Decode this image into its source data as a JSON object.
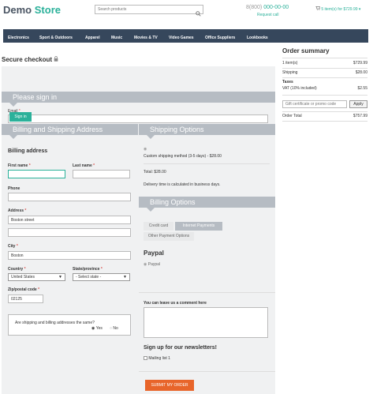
{
  "header": {
    "logo_part1": "Demo",
    "logo_part2": "Store",
    "search_placeholder": "Search products",
    "phone_prefix": "8(800)",
    "phone_number": "000-00-00",
    "request_call": "Request call",
    "cart_text": "5 item(s) for $729.99"
  },
  "nav": [
    "Electronics",
    "Sport & Outdoors",
    "Apparel",
    "Music",
    "Movies & TV",
    "Video Games",
    "Office Suppliers",
    "Lookbooks"
  ],
  "checkout": {
    "title": "Secure checkout",
    "sign_in_band": "Please sign in",
    "email_label": "Email",
    "sign_in_button": "Sign in",
    "billing_shipping_band": "Billing and Shipping Address",
    "billing_address_title": "Billing address",
    "first_name_label": "First name",
    "last_name_label": "Last name",
    "phone_label": "Phone",
    "address_label": "Address",
    "address_value": "Boston street",
    "city_label": "City",
    "city_value": "Boston",
    "country_label": "Country",
    "country_value": "United States",
    "state_label": "State/province",
    "state_value": "- Select state -",
    "zip_label": "Zip/postal code",
    "zip_value": "02125",
    "same_address_question": "Are shipping and billing addresses the same?",
    "yes_label": "Yes",
    "no_label": "No"
  },
  "shipping": {
    "band": "Shipping Options",
    "method": "Custom shipping method (3-5 days) - $28.00",
    "total": "Total: $28.00",
    "note": "Delivery time is calculated in business days."
  },
  "billing": {
    "band": "Billing Options",
    "tabs": [
      "Credit card",
      "Internet Payments",
      "Other Payment Options"
    ],
    "paypal_title": "Paypal",
    "paypal_option": "Paypal",
    "comment_label": "You can leave us a comment here",
    "newsletter_title": "Sign up for our newsletters!",
    "mailing_list": "Mailing list 1",
    "submit": "SUBMIT MY ORDER"
  },
  "summary": {
    "title": "Order summary",
    "items_label": "1 item(s)",
    "items_value": "$729.99",
    "shipping_label": "Shipping",
    "shipping_value": "$28.00",
    "taxes_label": "Taxes",
    "vat_label": "VAT (10% included)",
    "vat_value": "$2.55",
    "promo_placeholder": "Gift certificate or promo code",
    "apply": "Apply",
    "total_label": "Order Total",
    "total_value": "$757.99"
  },
  "colors": {
    "brand_green": "#2bb19a",
    "nav_bg": "#36475c",
    "band_bg": "#b6bcc3",
    "submit_bg": "#e8652a"
  }
}
